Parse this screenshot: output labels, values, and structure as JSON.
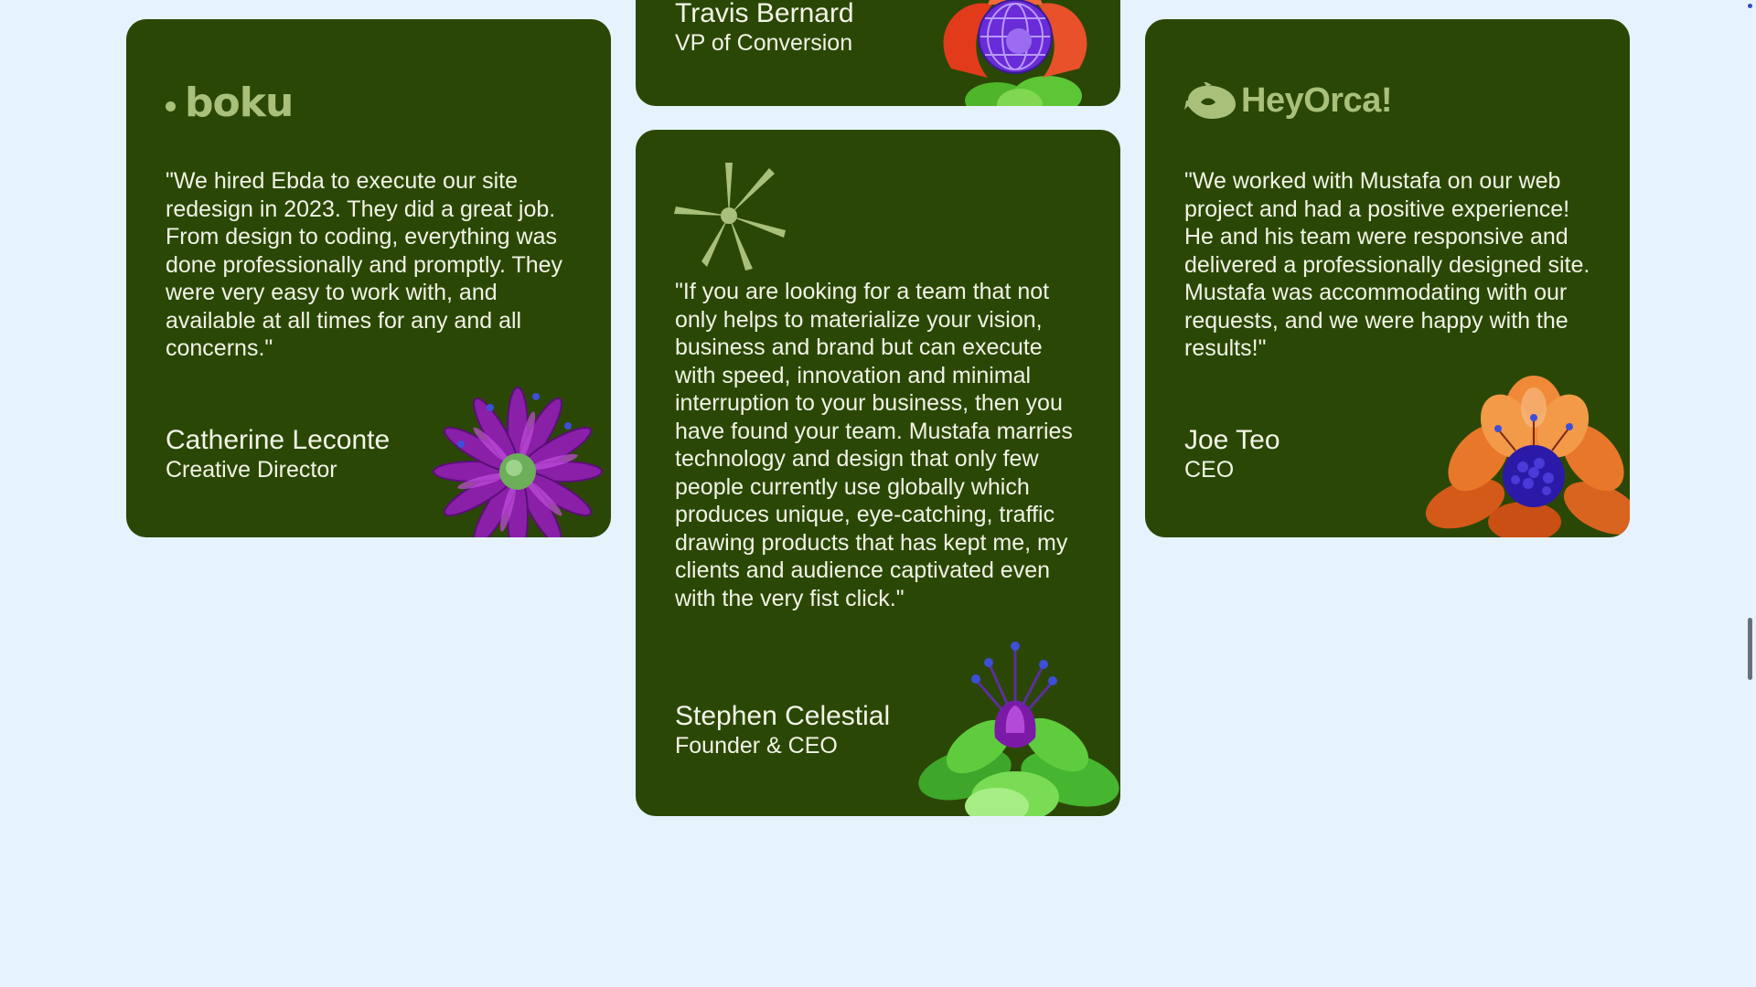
{
  "testimonials": {
    "top": {
      "name": "Travis Bernard",
      "role": "VP of Conversion",
      "flower_icon": "red-blue-flower-icon"
    },
    "left": {
      "logo_text": "boku",
      "quote": "\"We hired Ebda to execute our site redesign in 2023. They did a great job. From design to coding, everything was done professionally and promptly. They were very easy to work with, and available at all times for any and all concerns.\"",
      "name": "Catherine Leconte",
      "role": "Creative Director",
      "flower_icon": "purple-flower-icon"
    },
    "middle": {
      "logo_icon": "star-sparkle-logo-icon",
      "quote": "\"If you are looking for a team that not only helps to materialize your vision, business and brand but can execute with speed, innovation and minimal interruption to your business, then you have found your team. Mustafa marries technology and design that only few people currently use globally which produces unique, eye-catching, traffic drawing products that has kept me, my clients and audience captivated even with the very fist click.\"",
      "name": "Stephen Celestial",
      "role": "Founder & CEO",
      "flower_icon": "green-succulent-flower-icon"
    },
    "right": {
      "logo_text": "HeyOrca!",
      "quote": "\"We worked with Mustafa on our web project and had a positive experience! He and his team were responsive and delivered a professionally designed site. Mustafa was accommodating with our requests, and we were happy with the results!\"",
      "name": "Joe Teo",
      "role": "CEO",
      "flower_icon": "orange-flower-icon"
    }
  },
  "colors": {
    "background": "#e6f3fd",
    "card": "#2b4705",
    "logo": "#a9c07a",
    "text": "#f1f4e6"
  }
}
